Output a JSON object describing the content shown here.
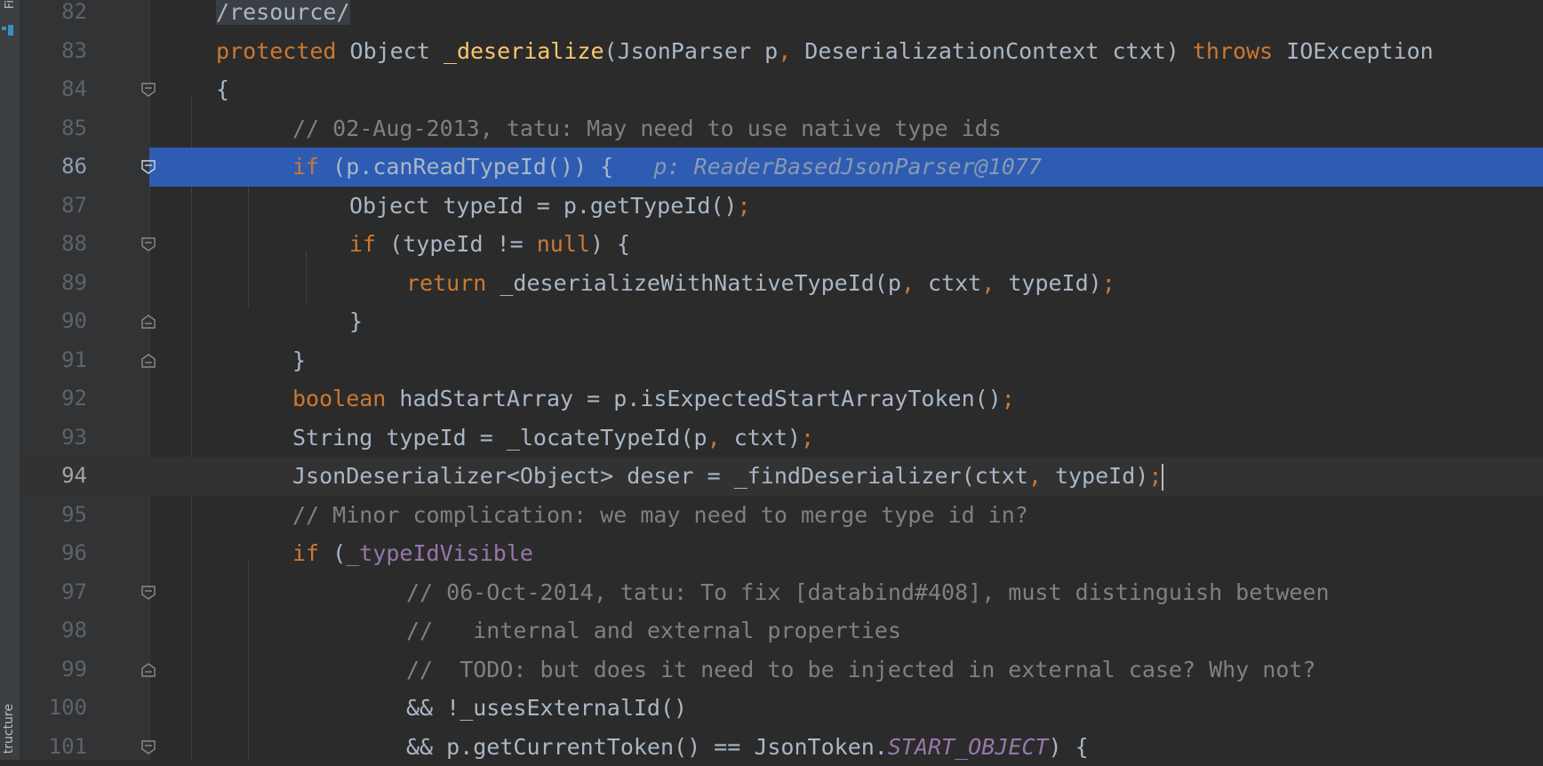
{
  "sidebar": {
    "top_label": "Fi",
    "bottom_label": "tructure"
  },
  "editor": {
    "inline_hint": "p: ReaderBasedJsonParser@1077",
    "lines": [
      {
        "num": "82",
        "text": "/resource/"
      },
      {
        "num": "83",
        "text": "protected Object _deserialize(JsonParser p, DeserializationContext ctxt) throws IOException"
      },
      {
        "num": "84",
        "text": "{"
      },
      {
        "num": "85",
        "text": "// 02-Aug-2013, tatu: May need to use native type ids"
      },
      {
        "num": "86",
        "text": "if (p.canReadTypeId()) {"
      },
      {
        "num": "87",
        "text": "Object typeId = p.getTypeId();"
      },
      {
        "num": "88",
        "text": "if (typeId != null) {"
      },
      {
        "num": "89",
        "text": "return _deserializeWithNativeTypeId(p, ctxt, typeId);"
      },
      {
        "num": "90",
        "text": "}"
      },
      {
        "num": "91",
        "text": "}"
      },
      {
        "num": "92",
        "text": "boolean hadStartArray = p.isExpectedStartArrayToken();"
      },
      {
        "num": "93",
        "text": "String typeId = _locateTypeId(p, ctxt);"
      },
      {
        "num": "94",
        "text": "JsonDeserializer<Object> deser = _findDeserializer(ctxt, typeId);"
      },
      {
        "num": "95",
        "text": "// Minor complication: we may need to merge type id in?"
      },
      {
        "num": "96",
        "text": "if (_typeIdVisible"
      },
      {
        "num": "97",
        "text": "// 06-Oct-2014, tatu: To fix [databind#408], must distinguish between"
      },
      {
        "num": "98",
        "text": "//   internal and external properties"
      },
      {
        "num": "99",
        "text": "//  TODO: but does it need to be injected in external case? Why not?"
      },
      {
        "num": "100",
        "text": "&& !_usesExternalId()"
      },
      {
        "num": "101",
        "text": "&& p.getCurrentToken() == JsonToken.START_OBJECT) {"
      }
    ]
  },
  "colors": {
    "background": "#2b2b2b",
    "gutter": "#313335",
    "selection": "#2f65ca",
    "keyword": "#cc7832",
    "comment": "#808080",
    "method_decl": "#ffc66d",
    "field": "#9876aa",
    "default_text": "#a9b7c6"
  }
}
